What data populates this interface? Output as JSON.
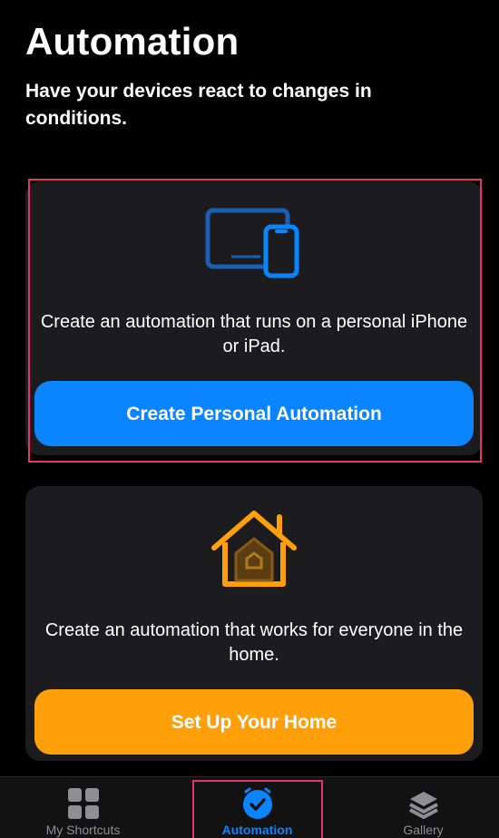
{
  "header": {
    "title": "Automation",
    "subtitle": "Have your devices react to changes in conditions."
  },
  "personal_card": {
    "icon": "devices-icon",
    "description": "Create an automation that runs on a personal iPhone or iPad.",
    "button_label": "Create Personal Automation",
    "accent_color": "#0a84ff"
  },
  "home_card": {
    "icon": "home-icon",
    "description": "Create an automation that works for everyone in the home.",
    "button_label": "Set Up Your Home",
    "accent_color": "#ff9f0a"
  },
  "tab_bar": {
    "tabs": [
      {
        "label": "My Shortcuts",
        "icon": "grid-icon",
        "active": false
      },
      {
        "label": "Automation",
        "icon": "clock-check-icon",
        "active": true
      },
      {
        "label": "Gallery",
        "icon": "layers-icon",
        "active": false
      }
    ]
  },
  "colors": {
    "background": "#000000",
    "card": "#1c1c1e",
    "highlight": "#e8326e",
    "inactive_tab": "#8e8e93"
  }
}
